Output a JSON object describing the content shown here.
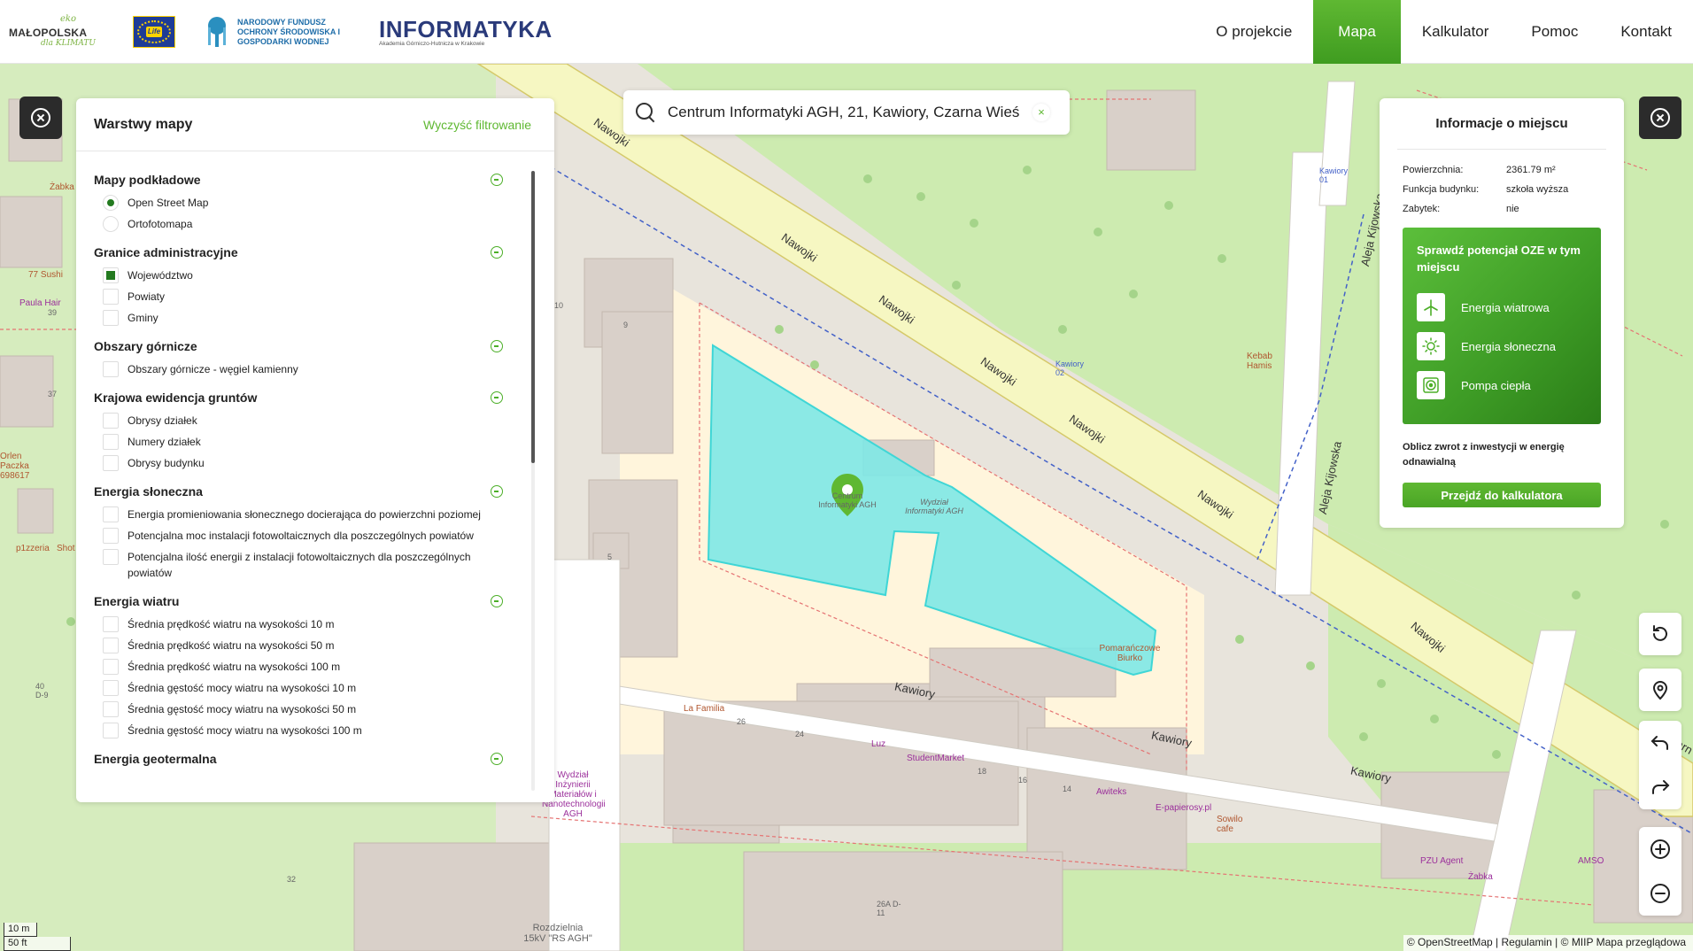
{
  "header": {
    "logos": {
      "malopolska_eko": "eko",
      "malopolska_name": "MAŁOPOLSKA",
      "malopolska_tagline": "dla KLIMATU",
      "life": "Life",
      "nfos": "NARODOWY FUNDUSZ OCHRONY ŚRODOWISKA I GOSPODARKI WODNEJ",
      "informatyka": "INFORMATYKA",
      "informatyka_sub": "Akademia Górniczo-Hutnicza w Krakowie"
    },
    "nav": [
      {
        "label": "O projekcie",
        "active": false
      },
      {
        "label": "Mapa",
        "active": true
      },
      {
        "label": "Kalkulator",
        "active": false
      },
      {
        "label": "Pomoc",
        "active": false
      },
      {
        "label": "Kontakt",
        "active": false
      }
    ],
    "accent": "#5fb832"
  },
  "layers": {
    "title": "Warstwy mapy",
    "clear_label": "Wyczyść filtrowanie",
    "groups": [
      {
        "title": "Mapy podkładowe",
        "type": "radio",
        "options": [
          {
            "label": "Open Street Map",
            "checked": true
          },
          {
            "label": "Ortofotomapa",
            "checked": false
          }
        ]
      },
      {
        "title": "Granice administracyjne",
        "type": "checkbox",
        "options": [
          {
            "label": "Województwo",
            "checked": true
          },
          {
            "label": "Powiaty",
            "checked": false
          },
          {
            "label": "Gminy",
            "checked": false
          }
        ]
      },
      {
        "title": "Obszary górnicze",
        "type": "checkbox",
        "options": [
          {
            "label": "Obszary górnicze - węgiel kamienny",
            "checked": false
          }
        ]
      },
      {
        "title": "Krajowa ewidencja gruntów",
        "type": "checkbox",
        "options": [
          {
            "label": "Obrysy działek",
            "checked": false
          },
          {
            "label": "Numery działek",
            "checked": false
          },
          {
            "label": "Obrysy budynku",
            "checked": false
          }
        ]
      },
      {
        "title": "Energia słoneczna",
        "type": "checkbox",
        "options": [
          {
            "label": "Energia promieniowania słonecznego docierająca do powierzchni poziomej",
            "checked": false
          },
          {
            "label": "Potencjalna moc instalacji fotowoltaicznych dla poszczególnych powiatów",
            "checked": false
          },
          {
            "label": "Potencjalna ilość energii z instalacji fotowoltaicznych dla poszczególnych powiatów",
            "checked": false
          }
        ]
      },
      {
        "title": "Energia wiatru",
        "type": "checkbox",
        "options": [
          {
            "label": "Średnia prędkość wiatru na wysokości 10 m",
            "checked": false
          },
          {
            "label": "Średnia prędkość wiatru na wysokości 50 m",
            "checked": false
          },
          {
            "label": "Średnia prędkość wiatru na wysokości 100 m",
            "checked": false
          },
          {
            "label": "Średnia gęstość mocy wiatru na wysokości 10 m",
            "checked": false
          },
          {
            "label": "Średnia gęstość mocy wiatru na wysokości 50 m",
            "checked": false
          },
          {
            "label": "Średnia gęstość mocy wiatru na wysokości 100 m",
            "checked": false
          }
        ]
      },
      {
        "title": "Energia geotermalna",
        "type": "checkbox",
        "options": []
      }
    ]
  },
  "search": {
    "value": "Centrum Informatyki AGH, 21, Kawiory, Czarna Wieś",
    "clear": "×"
  },
  "info": {
    "title": "Informacje o miejscu",
    "attributes": [
      {
        "key": "Powierzchnia:",
        "value": "2361.79 m²"
      },
      {
        "key": "Funkcja budynku:",
        "value": "szkoła wyższa"
      },
      {
        "key": "Zabytek:",
        "value": "nie"
      }
    ],
    "oze_title": "Sprawdź potencjał OZE w tym miejscu",
    "oze_items": [
      {
        "label": "Energia wiatrowa",
        "icon": "wind-turbine-icon"
      },
      {
        "label": "Energia słoneczna",
        "icon": "sun-icon"
      },
      {
        "label": "Pompa ciepła",
        "icon": "heat-pump-icon"
      }
    ],
    "calc_text": "Oblicz zwrot z inwestycji w energię odnawialną",
    "calc_button": "Przejdź do kalkulatora"
  },
  "map": {
    "streets": {
      "nawojki": "Nawojki",
      "kawiory": "Kawiory",
      "aleja_kijowska": "Aleja Kijowska",
      "czarna": "Czarn"
    },
    "building_labels": {
      "centrum": "Centrum Informatyki AGH",
      "wydzial": "Wydział Informatyki AGH",
      "pomaranczowe": "Pomarańczowe Biurko",
      "wydzial_inz": "Wydział Inżynierii Materiałów i Nanotechnologii AGH",
      "rozdzielnia": "Rozdzielnia 15kV \"RS AGH\""
    },
    "pois": {
      "zabka_left": "Żabka",
      "sushi": "77 Sushi",
      "paula_hair": "Paula Hair",
      "orlen": "Orlen Paczka 698617",
      "pizzeria": "p1zzeria",
      "shot": "Shot",
      "kebab": "Kebab Hamis",
      "kawiory01": "Kawiory 01",
      "kawiory02": "Kawiory 02",
      "la_familia": "La Familia",
      "luz": "Luz",
      "student_market": "StudentMarket",
      "awiteks": "Awiteks",
      "e_papierosy": "E-papierosy.pl",
      "sowilo": "Sowilo cafe",
      "pzu": "PZU Agent",
      "zabka_right": "Żabka",
      "amso": "AMSO"
    },
    "house_numbers": [
      "39",
      "37",
      "40 D-9",
      "10",
      "9",
      "5",
      "26",
      "24",
      "18",
      "16",
      "14",
      "32",
      "26A D-11"
    ],
    "colors": {
      "selected_building": "#7ee8e5",
      "selected_outline": "#3fd6d6",
      "grass": "#cdebb0",
      "park": "#c8e6a8",
      "building": "#d9d0c9",
      "road": "#ffffff",
      "primary_road": "#f7fabf",
      "campus": "#fff5dc",
      "marker": "#5fb832"
    }
  },
  "controls": {
    "refresh": "refresh-icon",
    "locate": "location-pin-icon",
    "undo": "undo-icon",
    "redo": "redo-icon",
    "zoom_in": "zoom-in-icon",
    "zoom_out": "zoom-out-icon"
  },
  "scale": {
    "metric": "10 m",
    "imperial": "50 ft"
  },
  "attribution": "© OpenStreetMap | Regulamin | © MIIP Mapa przeglądowa"
}
